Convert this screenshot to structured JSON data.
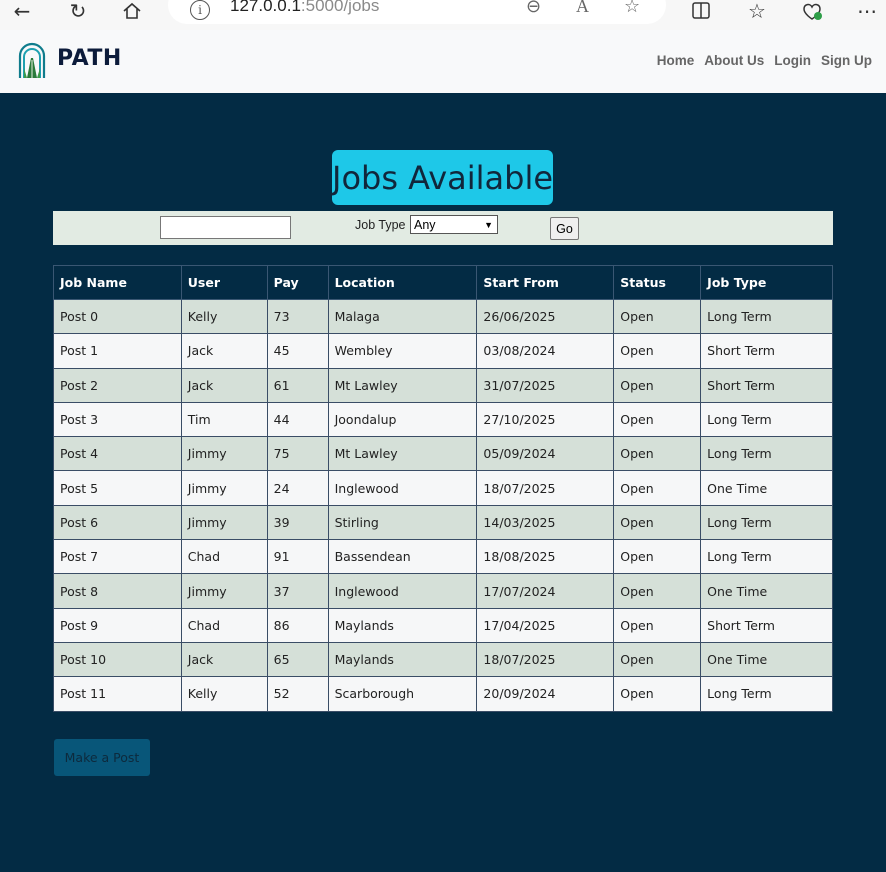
{
  "browser": {
    "address": {
      "host": "127.0.0.1",
      "rest": ":5000/jobs"
    },
    "icons": [
      "back-arrow-icon",
      "refresh-icon",
      "home-icon",
      "info-icon",
      "zoom-out-icon",
      "read-aloud-icon",
      "favorite-star-icon",
      "split-screen-icon",
      "favorites-icon",
      "browser-essentials-icon",
      "more-icon"
    ]
  },
  "nav": {
    "brand": "PATH",
    "links": [
      "Home",
      "About Us",
      "Login",
      "Sign Up"
    ]
  },
  "page": {
    "title": "Jobs Available"
  },
  "filters": {
    "search_value": "",
    "job_type_label": "Job Type",
    "job_type_selected": "Any",
    "go_label": "Go"
  },
  "table": {
    "headers": [
      "Job Name",
      "User",
      "Pay",
      "Location",
      "Start From",
      "Status",
      "Job Type"
    ],
    "rows": [
      [
        "Post 0",
        "Kelly",
        "73",
        "Malaga",
        "26/06/2025",
        "Open",
        "Long Term"
      ],
      [
        "Post 1",
        "Jack",
        "45",
        "Wembley",
        "03/08/2024",
        "Open",
        "Short Term"
      ],
      [
        "Post 2",
        "Jack",
        "61",
        "Mt Lawley",
        "31/07/2025",
        "Open",
        "Short Term"
      ],
      [
        "Post 3",
        "Tim",
        "44",
        "Joondalup",
        "27/10/2025",
        "Open",
        "Long Term"
      ],
      [
        "Post 4",
        "Jimmy",
        "75",
        "Mt Lawley",
        "05/09/2024",
        "Open",
        "Long Term"
      ],
      [
        "Post 5",
        "Jimmy",
        "24",
        "Inglewood",
        "18/07/2025",
        "Open",
        "One Time"
      ],
      [
        "Post 6",
        "Jimmy",
        "39",
        "Stirling",
        "14/03/2025",
        "Open",
        "Long Term"
      ],
      [
        "Post 7",
        "Chad",
        "91",
        "Bassendean",
        "18/08/2025",
        "Open",
        "Long Term"
      ],
      [
        "Post 8",
        "Jimmy",
        "37",
        "Inglewood",
        "17/07/2024",
        "Open",
        "One Time"
      ],
      [
        "Post 9",
        "Chad",
        "86",
        "Maylands",
        "17/04/2025",
        "Open",
        "Short Term"
      ],
      [
        "Post 10",
        "Jack",
        "65",
        "Maylands",
        "18/07/2025",
        "Open",
        "One Time"
      ],
      [
        "Post 11",
        "Kelly",
        "52",
        "Scarborough",
        "20/09/2024",
        "Open",
        "Long Term"
      ]
    ]
  },
  "actions": {
    "make_post_label": "Make a Post"
  },
  "colors": {
    "page_bg": "#032b44",
    "title_bg": "#1ec8e8",
    "row_odd": "#d5e0d8",
    "row_even": "#f6f7f8",
    "button_bg": "#085679"
  }
}
